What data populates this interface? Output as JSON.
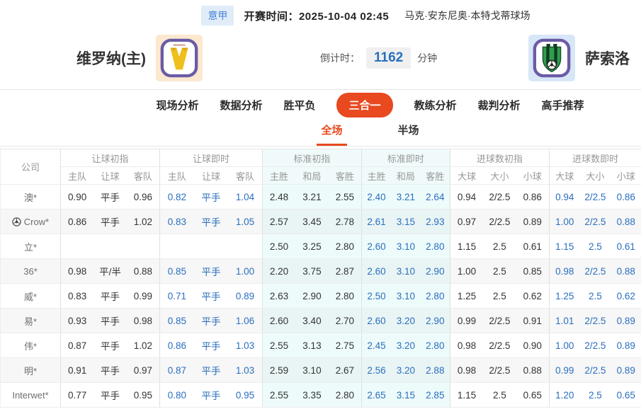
{
  "top_bar": {
    "league_badge": "意甲",
    "kickoff_label": "开赛时间：",
    "kickoff_time": "2025-10-04 02:45",
    "venue": "马克·安东尼奥·本特戈蒂球场"
  },
  "match_header": {
    "home_team": "维罗纳(主)",
    "away_team": "萨索洛",
    "countdown_label": "倒计时：",
    "countdown_value": "1162",
    "countdown_unit": "分钟"
  },
  "icons": {
    "home_logo": "verona-crest",
    "away_logo": "sassuolo-crest",
    "company_row_icon": "soccer-ball"
  },
  "nav_tabs": [
    {
      "label": "现场分析",
      "active": false
    },
    {
      "label": "数据分析",
      "active": false
    },
    {
      "label": "胜平负",
      "active": false
    },
    {
      "label": "三合一",
      "active": true
    },
    {
      "label": "教练分析",
      "active": false
    },
    {
      "label": "裁判分析",
      "active": false
    },
    {
      "label": "高手推荐",
      "active": false
    }
  ],
  "sub_tabs": [
    {
      "label": "全场",
      "active": true
    },
    {
      "label": "半场",
      "active": false
    }
  ],
  "odds_table": {
    "company_header": "公司",
    "groups": [
      {
        "label": "让球初指",
        "cols": [
          "主队",
          "让球",
          "客队"
        ],
        "live": false,
        "tint": false
      },
      {
        "label": "让球即时",
        "cols": [
          "主队",
          "让球",
          "客队"
        ],
        "live": true,
        "tint": false
      },
      {
        "label": "标准初指",
        "cols": [
          "主胜",
          "和局",
          "客胜"
        ],
        "live": false,
        "tint": true
      },
      {
        "label": "标准即时",
        "cols": [
          "主胜",
          "和局",
          "客胜"
        ],
        "live": true,
        "tint": true
      },
      {
        "label": "进球数初指",
        "cols": [
          "大球",
          "大小",
          "小球"
        ],
        "live": false,
        "tint": false
      },
      {
        "label": "进球数即时",
        "cols": [
          "大球",
          "大小",
          "小球"
        ],
        "live": true,
        "tint": false
      }
    ],
    "rows": [
      {
        "company": "澳*",
        "icon": false,
        "values": [
          [
            "0.90",
            "平手",
            "0.96"
          ],
          [
            "0.82",
            "平手",
            "1.04"
          ],
          [
            "2.48",
            "3.21",
            "2.55"
          ],
          [
            "2.40",
            "3.21",
            "2.64"
          ],
          [
            "0.94",
            "2/2.5",
            "0.86"
          ],
          [
            "0.94",
            "2/2.5",
            "0.86"
          ]
        ]
      },
      {
        "company": "Crow*",
        "icon": true,
        "values": [
          [
            "0.86",
            "平手",
            "1.02"
          ],
          [
            "0.83",
            "平手",
            "1.05"
          ],
          [
            "2.57",
            "3.45",
            "2.78"
          ],
          [
            "2.61",
            "3.15",
            "2.93"
          ],
          [
            "0.97",
            "2/2.5",
            "0.89"
          ],
          [
            "1.00",
            "2/2.5",
            "0.88"
          ]
        ]
      },
      {
        "company": "立*",
        "icon": false,
        "values": [
          [
            "",
            "",
            ""
          ],
          [
            "",
            "",
            ""
          ],
          [
            "2.50",
            "3.25",
            "2.80"
          ],
          [
            "2.60",
            "3.10",
            "2.80"
          ],
          [
            "1.15",
            "2.5",
            "0.61"
          ],
          [
            "1.15",
            "2.5",
            "0.61"
          ]
        ]
      },
      {
        "company": "36*",
        "icon": false,
        "values": [
          [
            "0.98",
            "平/半",
            "0.88"
          ],
          [
            "0.85",
            "平手",
            "1.00"
          ],
          [
            "2.20",
            "3.75",
            "2.87"
          ],
          [
            "2.60",
            "3.10",
            "2.90"
          ],
          [
            "1.00",
            "2.5",
            "0.85"
          ],
          [
            "0.98",
            "2/2.5",
            "0.88"
          ]
        ]
      },
      {
        "company": "威*",
        "icon": false,
        "values": [
          [
            "0.83",
            "平手",
            "0.99"
          ],
          [
            "0.71",
            "平手",
            "0.89"
          ],
          [
            "2.63",
            "2.90",
            "2.80"
          ],
          [
            "2.50",
            "3.10",
            "2.80"
          ],
          [
            "1.25",
            "2.5",
            "0.62"
          ],
          [
            "1.25",
            "2.5",
            "0.62"
          ]
        ]
      },
      {
        "company": "易*",
        "icon": false,
        "values": [
          [
            "0.93",
            "平手",
            "0.98"
          ],
          [
            "0.85",
            "平手",
            "1.06"
          ],
          [
            "2.60",
            "3.40",
            "2.70"
          ],
          [
            "2.60",
            "3.20",
            "2.90"
          ],
          [
            "0.99",
            "2/2.5",
            "0.91"
          ],
          [
            "1.01",
            "2/2.5",
            "0.89"
          ]
        ]
      },
      {
        "company": "伟*",
        "icon": false,
        "values": [
          [
            "0.87",
            "平手",
            "1.02"
          ],
          [
            "0.86",
            "平手",
            "1.03"
          ],
          [
            "2.55",
            "3.13",
            "2.75"
          ],
          [
            "2.45",
            "3.20",
            "2.80"
          ],
          [
            "0.98",
            "2/2.5",
            "0.90"
          ],
          [
            "1.00",
            "2/2.5",
            "0.89"
          ]
        ]
      },
      {
        "company": "明*",
        "icon": false,
        "values": [
          [
            "0.91",
            "平手",
            "0.97"
          ],
          [
            "0.87",
            "平手",
            "1.03"
          ],
          [
            "2.59",
            "3.10",
            "2.67"
          ],
          [
            "2.56",
            "3.20",
            "2.88"
          ],
          [
            "0.98",
            "2/2.5",
            "0.88"
          ],
          [
            "0.99",
            "2/2.5",
            "0.89"
          ]
        ]
      },
      {
        "company": "Interwet*",
        "icon": false,
        "values": [
          [
            "0.77",
            "平手",
            "0.95"
          ],
          [
            "0.80",
            "平手",
            "0.95"
          ],
          [
            "2.55",
            "3.35",
            "2.80"
          ],
          [
            "2.65",
            "3.15",
            "2.85"
          ],
          [
            "1.15",
            "2.5",
            "0.65"
          ],
          [
            "1.20",
            "2.5",
            "0.65"
          ]
        ]
      }
    ]
  },
  "colors": {
    "accent_orange": "#e8491f",
    "live_blue": "#2a6ebe",
    "badge_blue_bg": "#e0ecf8",
    "badge_blue_text": "#4585d6",
    "standard_tint_cyan": "#edfbfb",
    "row_alt_gray": "#f7f7f7"
  },
  "column_widths": {
    "company": 85,
    "groups": [
      140,
      145,
      140,
      125,
      140,
      130
    ]
  }
}
